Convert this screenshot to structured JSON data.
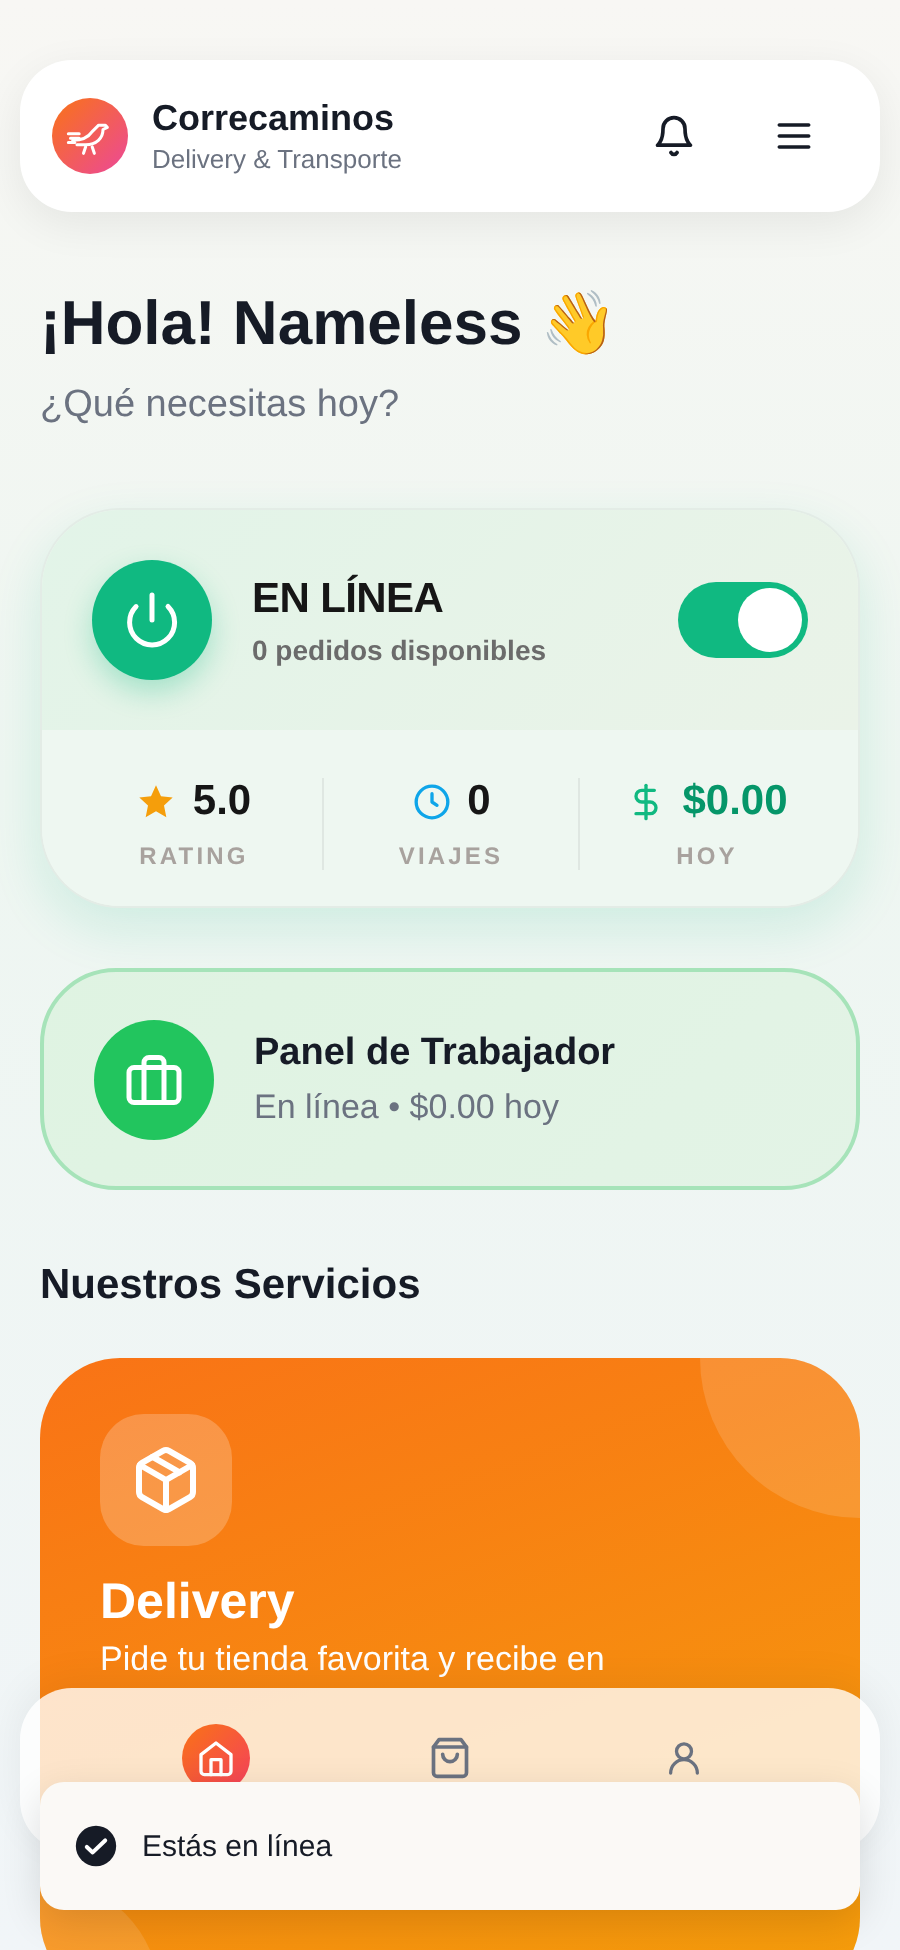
{
  "header": {
    "title": "Correcaminos",
    "subtitle": "Delivery & Transporte"
  },
  "greeting": {
    "title": "¡Hola! Nameless 👋",
    "subtitle": "¿Qué necesitas hoy?"
  },
  "status": {
    "title": "EN LÍNEA",
    "subtitle": "0 pedidos disponibles",
    "on": true,
    "stats": [
      {
        "kind": "rating",
        "value": "5.0",
        "label": "RATING"
      },
      {
        "kind": "trips",
        "value": "0",
        "label": "VIAJES"
      },
      {
        "kind": "money",
        "value": "$0.00",
        "label": "HOY"
      }
    ]
  },
  "worker_panel": {
    "title": "Panel de Trabajador",
    "subtitle": "En línea • $0.00 hoy"
  },
  "services": {
    "title": "Nuestros Servicios",
    "items": [
      {
        "kind": "delivery",
        "title": "Delivery",
        "description": "Pide tu tienda favorita y recibe en"
      }
    ]
  },
  "nav": [
    {
      "kind": "home",
      "selected": true
    },
    {
      "kind": "orders",
      "selected": false
    },
    {
      "kind": "profile",
      "selected": false
    }
  ],
  "toast": {
    "message": "Estás en línea"
  }
}
